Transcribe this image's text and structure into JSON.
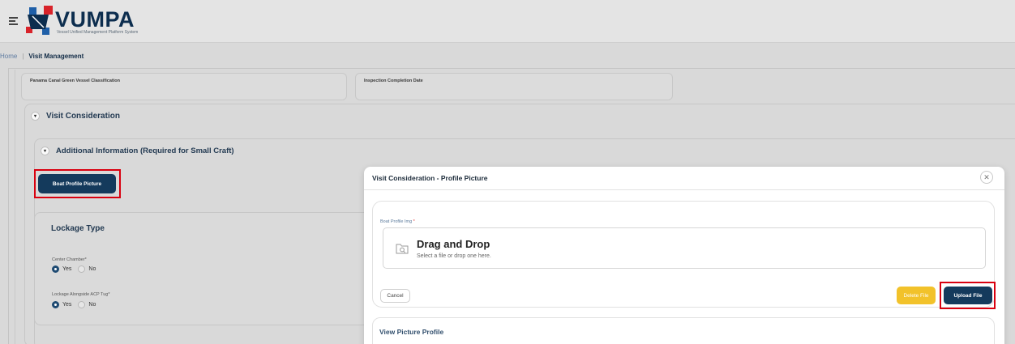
{
  "header": {
    "logo_text": "VUMPA",
    "logo_subtitle": "Vessel Unified Management Platform System"
  },
  "breadcrumb": {
    "home": "Home",
    "separator": "|",
    "current": "Visit Management"
  },
  "fields": {
    "green_classification_label": "Panama Canal Green Vessel Classification",
    "inspection_date_label": "Inspection Completion Date"
  },
  "sections": {
    "visit_consideration": "Visit Consideration",
    "additional_info": "Additional Information (Required for Small Craft)"
  },
  "boat_profile_button": "Boat Profile Picture",
  "lockage": {
    "title": "Lockage Type",
    "center_chamber_label": "Center Chamber",
    "alongside_tug_label": "Lockage Alongside ACP Tug",
    "required_mark": "*",
    "yes": "Yes",
    "no": "No",
    "center_chamber_value": "Yes",
    "alongside_tug_value": "Yes"
  },
  "modal": {
    "title": "Visit Consideration - Profile Picture",
    "close_icon": "close-icon",
    "field_label": "Boat Profile Img",
    "required_mark": "*",
    "drop_title": "Drag and Drop",
    "drop_subtitle": "Select a file or drop one here.",
    "cancel_label": "Cancel",
    "delete_label": "Delete File",
    "upload_label": "Upload File",
    "view_title": "View Picture Profile"
  },
  "colors": {
    "navy": "#143a5c",
    "highlight_red": "#d9000f",
    "delete_yellow": "#f2c22a"
  }
}
